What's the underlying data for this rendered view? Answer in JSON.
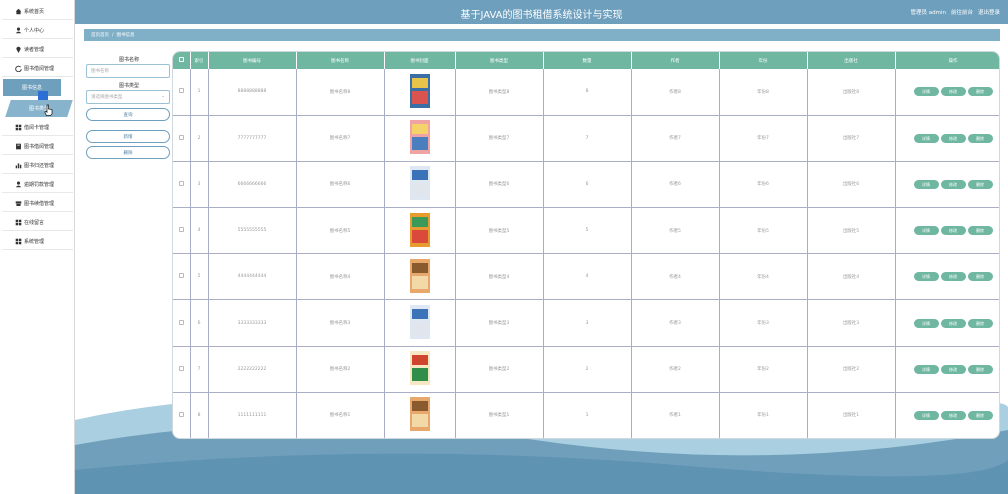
{
  "header": {
    "title": "基于JAVA的图书租借系统设计与实现",
    "admin_label": "管理员 admin",
    "front_label": "前往前台",
    "logout_label": "退出登录"
  },
  "sidebar": {
    "items": [
      {
        "label": "系统首页",
        "icon": "home-icon"
      },
      {
        "label": "个人中心",
        "icon": "user-icon"
      },
      {
        "label": "读者管理",
        "icon": "pin-icon"
      },
      {
        "label": "图书借阅管理",
        "icon": "refresh-icon"
      },
      {
        "label": "图书信息",
        "icon": ""
      },
      {
        "label": "图书类型",
        "icon": ""
      },
      {
        "label": "借阅卡管理",
        "icon": "grid-icon"
      },
      {
        "label": "图书借阅管理",
        "icon": "book-icon"
      },
      {
        "label": "图书归还管理",
        "icon": "chart-icon"
      },
      {
        "label": "逾期罚款管理",
        "icon": "user-icon"
      },
      {
        "label": "图书续借管理",
        "icon": "box-icon"
      },
      {
        "label": "在线留言",
        "icon": "grid-icon"
      },
      {
        "label": "系统管理",
        "icon": "grid-icon"
      }
    ]
  },
  "breadcrumb": {
    "home": "首页首页",
    "sep": "/",
    "current": "图书信息"
  },
  "search": {
    "name_label": "图书名称",
    "name_placeholder": "图书名称",
    "type_label": "图书类型",
    "type_placeholder": "请选择图书类型",
    "query_button": "查询",
    "add_button": "新增",
    "delete_button": "删除"
  },
  "table": {
    "headers": [
      "",
      "索引",
      "图书编号",
      "图书名称",
      "图书封面",
      "图书类型",
      "数量",
      "作者",
      "年份",
      "出版社",
      "操作"
    ],
    "rows": [
      {
        "idx": "1",
        "code": "8888888888",
        "name": "图书名称8",
        "type": "图书类型8",
        "qty": "8",
        "author": "作者8",
        "year": "年份8",
        "publisher": "出版社8"
      },
      {
        "idx": "2",
        "code": "7777777777",
        "name": "图书名称7",
        "type": "图书类型7",
        "qty": "7",
        "author": "作者7",
        "year": "年份7",
        "publisher": "出版社7"
      },
      {
        "idx": "3",
        "code": "6666666666",
        "name": "图书名称6",
        "type": "图书类型6",
        "qty": "6",
        "author": "作者6",
        "year": "年份6",
        "publisher": "出版社6"
      },
      {
        "idx": "4",
        "code": "5555555555",
        "name": "图书名称5",
        "type": "图书类型5",
        "qty": "5",
        "author": "作者5",
        "year": "年份5",
        "publisher": "出版社5"
      },
      {
        "idx": "5",
        "code": "4444444444",
        "name": "图书名称4",
        "type": "图书类型4",
        "qty": "4",
        "author": "作者4",
        "year": "年份4",
        "publisher": "出版社4"
      },
      {
        "idx": "6",
        "code": "3333333333",
        "name": "图书名称3",
        "type": "图书类型3",
        "qty": "3",
        "author": "作者3",
        "year": "年份3",
        "publisher": "出版社3"
      },
      {
        "idx": "7",
        "code": "2222222222",
        "name": "图书名称2",
        "type": "图书类型2",
        "qty": "2",
        "author": "作者2",
        "year": "年份2",
        "publisher": "出版社2"
      },
      {
        "idx": "8",
        "code": "1111111111",
        "name": "图书名称1",
        "type": "图书类型1",
        "qty": "1",
        "author": "作者1",
        "year": "年份1",
        "publisher": "出版社1"
      }
    ],
    "actions": {
      "detail": "详情",
      "edit": "修改",
      "delete": "删除"
    }
  },
  "colors": {
    "accent": "#6e9fbd",
    "table_header": "#6fb7a0",
    "action": "#6fb7a0"
  }
}
